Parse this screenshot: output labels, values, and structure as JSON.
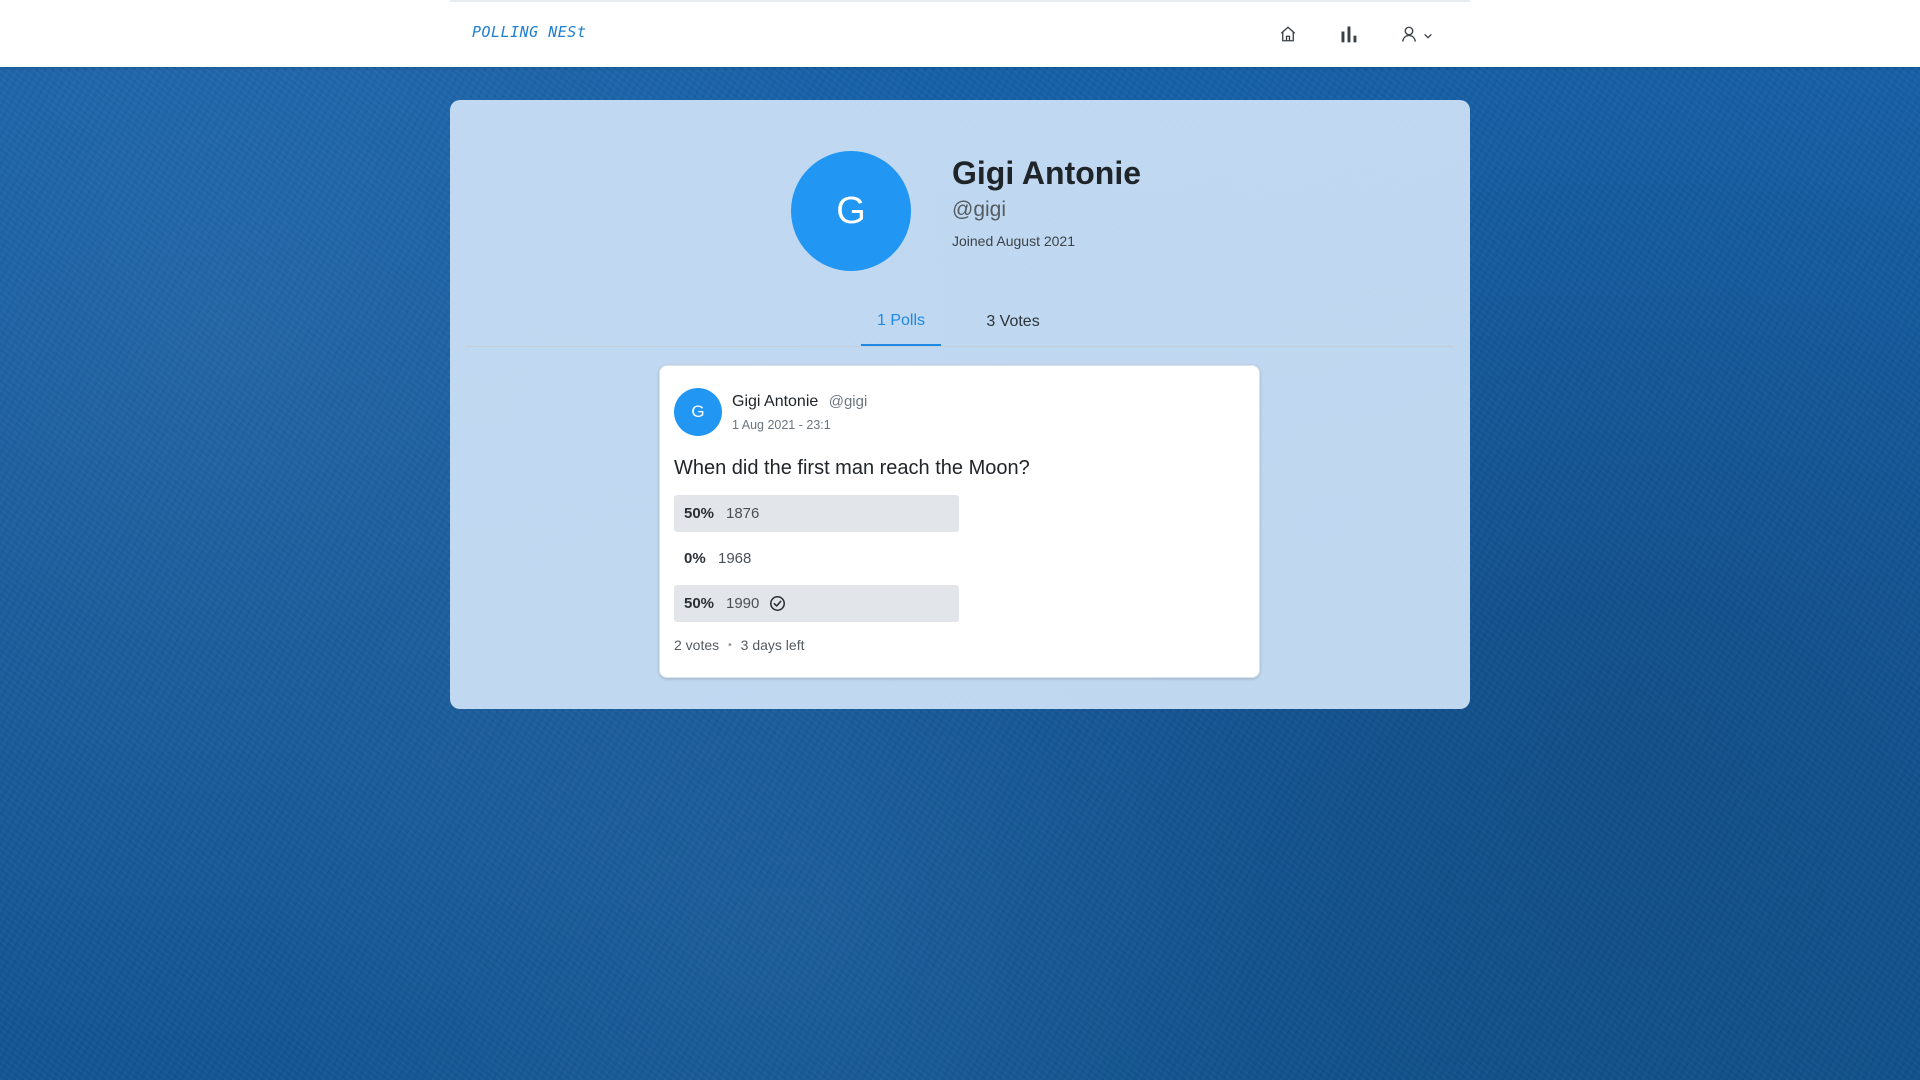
{
  "nav": {
    "brand": "POLLING NESt",
    "icons": [
      "home-icon",
      "bar-chart-icon",
      "user-icon",
      "chevron-down-icon"
    ]
  },
  "profile": {
    "initial": "G",
    "name": "Gigi Antonie",
    "handle": "@gigi",
    "joined": "Joined August 2021"
  },
  "tabs": [
    {
      "label": "1 Polls",
      "active": true
    },
    {
      "label": "3 Votes",
      "active": false
    }
  ],
  "poll": {
    "author_initial": "G",
    "author_name": "Gigi Antonie",
    "author_handle": "@gigi",
    "date": "1 Aug 2021 - 23:1",
    "question": "When did the first man reach the Moon?",
    "options": [
      {
        "percent": "50%",
        "label": "1876",
        "fraction": 0.5,
        "voted": false
      },
      {
        "percent": "0%",
        "label": "1968",
        "fraction": 0.0,
        "voted": false
      },
      {
        "percent": "50%",
        "label": "1990",
        "fraction": 0.5,
        "voted": true
      }
    ],
    "votes": "2 votes",
    "separator": "•",
    "time_left": "3 days left"
  },
  "colors": {
    "accent": "#1e88e5",
    "avatar": "#2196f3",
    "background": "#145a9c",
    "panel": "#cee3f7",
    "option_fill": "#e2e6ea"
  }
}
